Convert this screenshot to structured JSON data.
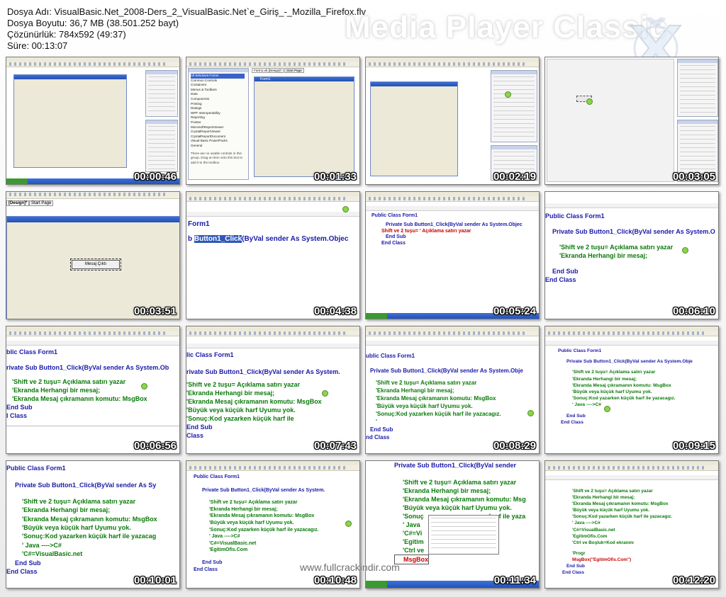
{
  "file_info": {
    "name_line": "Dosya Adı: VisualBasic.Net_2008-Ders_2_VisualBasic.Net`e_Giriş_-_Mozilla_Firefox.flv",
    "size_line": "Dosya Boyutu: 36,7 MB (38.501.252 bayt)",
    "resolution_line": "Çözünürlük: 784x592 (49:37)",
    "duration_line": "Süre: 00:13:07"
  },
  "brand": {
    "title": "Media Player Classic",
    "logo_icon": "mpc-x-icon"
  },
  "watermark": "www.fullcrackindir.com",
  "thumbnails": [
    {
      "time": "00:00:46"
    },
    {
      "time": "00:01:33",
      "toolbox_items": [
        "All Windows Forms",
        "Common Controls",
        "Containers",
        "Menus & Toolbars",
        "Data",
        "Components",
        "Printing",
        "Dialogs",
        "WPF Interoperability",
        "Reporting",
        "Pointer",
        "MicrosoftReportViewer",
        "CrystalReportViewer",
        "CrystalReportDocument",
        "Visual Basic PowerPacks",
        "General"
      ],
      "toolbox_note": "There are no usable controls in this group. Drag an item onto this text to add it to the toolbox.",
      "form_tab": "Form1.vb [Design]*",
      "start_tab": "Start Page",
      "form_caption": "Form1"
    },
    {
      "time": "00:02:19"
    },
    {
      "time": "00:03:05"
    },
    {
      "time": "00:03:51",
      "design_tab": "[Design]*",
      "start_tab": "Start Page",
      "button_text": "Mesaj Çıktı"
    },
    {
      "time": "00:04:38",
      "line1": "Form1",
      "line2_sel": "Button1_Click",
      "line2_prefix": "b",
      "line2_rest": "(ByVal sender As System.Objec"
    },
    {
      "time": "00:05:24",
      "lines": [
        "Public Class Form1",
        "Private Sub Button1_Click(ByVal sender As System.Objec",
        "Shift ve 2 tuşu= ' Açıklama satırı yazar",
        "End Sub",
        "End Class"
      ]
    },
    {
      "time": "00:06:10",
      "lines": [
        "Public Class Form1",
        "Private Sub Button1_Click(ByVal sender As System.O",
        "'Shift ve 2 tuşu=   Açıklama satırı yazar",
        "'Ekranda Herhangi bir mesaj;",
        "End Sub",
        "End Class"
      ]
    },
    {
      "time": "00:06:56",
      "lines": [
        "blic Class Form1",
        "rivate Sub Button1_Click(ByVal sender As System.Ob",
        "'Shift ve 2 tuşu=   Açıklama satırı yazar",
        "'Ekranda Herhangi bir mesaj;",
        "'Ekranda Mesaj çıkramanın komutu: MsgBox",
        "End Sub",
        "l Class"
      ]
    },
    {
      "time": "00:07:43",
      "lines": [
        "lic Class Form1",
        "rivate Sub Button1_Click(ByVal sender As System.",
        "'Shift ve 2 tuşu=   Açıklama satırı yazar",
        "'Ekranda Herhangi bir mesaj;",
        "'Ekranda Mesaj çıkramanın komutu: MsgBox",
        "'Büyük veya küçük harf Uyumu yok.",
        "'Sonuç:Kod yazarken küçük harf ile",
        "End Sub",
        "Class"
      ]
    },
    {
      "time": "00:08:29",
      "lines": [
        "ublic Class Form1",
        "Private Sub Button1_Click(ByVal sender As System.Obje",
        "'Shift ve 2 tuşu=   Açıklama satırı yazar",
        "'Ekranda Herhangi bir mesaj;",
        "'Ekranda Mesaj çıkramanın komutu: MsgBox",
        "'Büyük veya küçük harf Uyumu yok.",
        "'Sonuç:Kod yazarken küçük harf ile yazacagız.",
        "'",
        "End Sub",
        "nd Class"
      ]
    },
    {
      "time": "00:09:15",
      "lines": [
        "Public Class Form1",
        "Private Sub Button1_Click(ByVal sender As System.Obje",
        "'Shift ve 2 tuşu=   Açıklama satırı yazar",
        "'Ekranda Herhangi bir mesaj;",
        "'Ekranda Mesaj çıkramanın komutu: MsgBox",
        "'Büyük veya küçük harf Uyumu yok.",
        "'Sonuç:Kod yazarken küçük harf ile yazacagız.",
        "' Java ---->C#",
        "End Sub",
        "End Class"
      ]
    },
    {
      "time": "00:10:01",
      "lines": [
        "Public Class Form1",
        "Private Sub Button1_Click(ByVal sender As Sy",
        "'Shift ve 2 tuşu=   Açıklama satırı yazar",
        "'Ekranda Herhangi bir mesaj;",
        "'Ekranda Mesaj çıkramanın komutu: MsgBox",
        "'Büyük veya küçük harf Uyumu yok.",
        "'Sonuç:Kod yazarken küçük harf ile yazacag",
        "' Java ---->C#",
        "'C#=VisualBasic.net",
        "End Sub",
        "End Class"
      ]
    },
    {
      "time": "00:10:48",
      "lines": [
        "Public Class Form1",
        "Private Sub Button1_Click(ByVal sender As System.",
        "'Shift ve 2 tuşu=   Açıklama satırı yazar",
        "'Ekranda Herhangi bir mesaj;",
        "'Ekranda Mesaj çıkramanın komutu: MsgBox",
        "'Büyük veya küçük harf Uyumu yok.",
        "'Sonuç:Kod yazarken küçük harf ile yazacagız.",
        "' Java ---->C#",
        "'C#=VisualBasic.net",
        "'EgitimOfis.Com",
        "End Sub",
        "End Class"
      ]
    },
    {
      "time": "00:11:34",
      "lines": [
        "Private Sub Button1_Click(ByVal sender",
        "'Shift ve 2 tuşu=   Açıklama satırı yazar",
        "'Ekranda Herhangi bir mesaj;",
        "'Ekranda Mesaj çıkramanın komutu: Msg",
        "'Büyük veya küçük harf Uyumu yok.",
        "'Sonuç",
        "harf ile yaza",
        "' Java",
        "'C#=Vi",
        "'Egitim",
        "'Ctrl ve",
        "MsgBox"
      ]
    },
    {
      "time": "00:12:20",
      "lines": [
        "'Shift ve 2 tuşu=   Açıklama satırı yazar",
        "'Ekranda Herhangi bir mesaj;",
        "'Ekranda Mesaj çıkramanın komutu: MsgBox",
        "'Büyük veya küçük harf Uyumu yok.",
        "'Sonuç:Kod yazarken küçük harf ile yazacagız.",
        "' Java ---->C#",
        "'C#=VisualBasic.net",
        "'EgitimOfis.Com",
        "'Ctrl ve Boşluk=Kod ekranını",
        "'Progr",
        "MsgBox(\"EgitimOfis.Com\")",
        "End Sub",
        "End Class"
      ]
    }
  ]
}
